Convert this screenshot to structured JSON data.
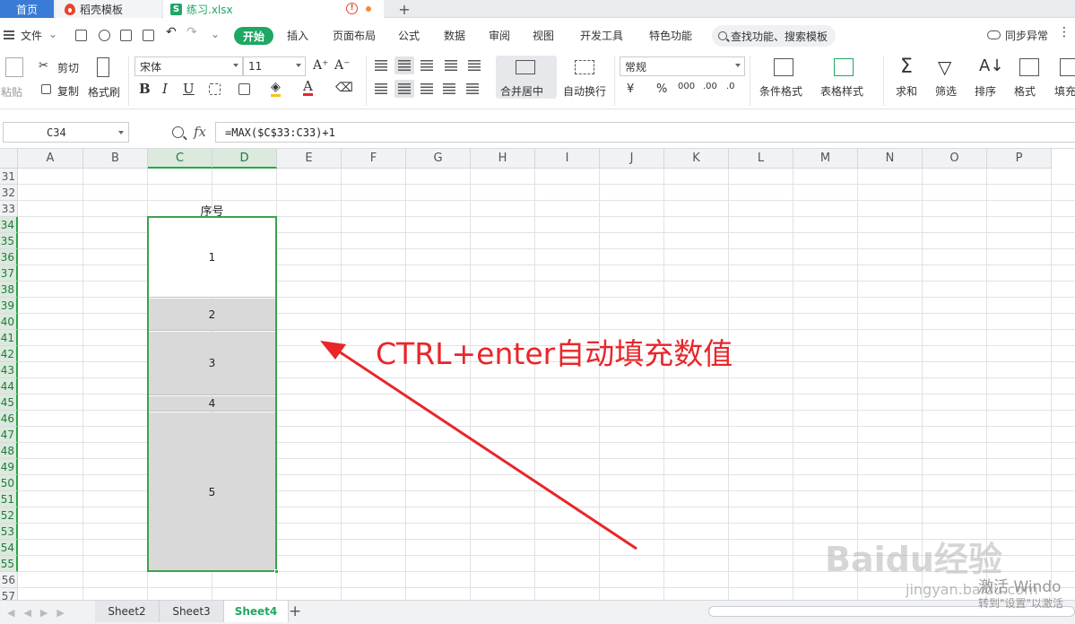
{
  "tabs": {
    "home": "首页",
    "template": "稻壳模板",
    "file": "练习.xlsx"
  },
  "menu": {
    "file": "文件",
    "start": "开始",
    "items": [
      "插入",
      "页面布局",
      "公式",
      "数据",
      "审阅",
      "视图",
      "开发工具",
      "特色功能"
    ],
    "search": "查找功能、搜索模板",
    "sync": "同步异常"
  },
  "ribbon": {
    "paste": "粘贴",
    "cut": "剪切",
    "copy": "复制",
    "format_painter": "格式刷",
    "font_name": "宋体",
    "font_size": "11",
    "number_format": "常规",
    "merge_center": "合并居中",
    "wrap_text": "自动换行",
    "conditional_format": "条件格式",
    "table_style": "表格样式",
    "sum": "求和",
    "filter": "筛选",
    "sort": "排序",
    "format": "格式",
    "fill": "填充"
  },
  "formula_bar": {
    "cell_ref": "C34",
    "fx": "fx",
    "formula": "=MAX($C$33:C33)+1"
  },
  "grid": {
    "columns": [
      "A",
      "B",
      "C",
      "D",
      "E",
      "F",
      "G",
      "H",
      "I",
      "J",
      "K",
      "L",
      "M",
      "N",
      "O",
      "P"
    ],
    "rows": [
      "31",
      "32",
      "33",
      "34",
      "35",
      "36",
      "37",
      "38",
      "39",
      "40",
      "41",
      "42",
      "43",
      "44",
      "45",
      "46",
      "47",
      "48",
      "49",
      "50",
      "51",
      "52",
      "53",
      "54",
      "55",
      "56",
      "57"
    ],
    "header_cell": "序号",
    "values": [
      "1",
      "2",
      "3",
      "4",
      "5"
    ]
  },
  "annotation": "CTRL+enter自动填充数值",
  "sheets": [
    "Sheet2",
    "Sheet3",
    "Sheet4"
  ],
  "active_sheet": "Sheet4",
  "watermark": {
    "brand": "Baidu经验",
    "url": "jingyan.baidu.com",
    "activate": "激活 Windo",
    "activate_sub": "转到\"设置\"以激活"
  }
}
